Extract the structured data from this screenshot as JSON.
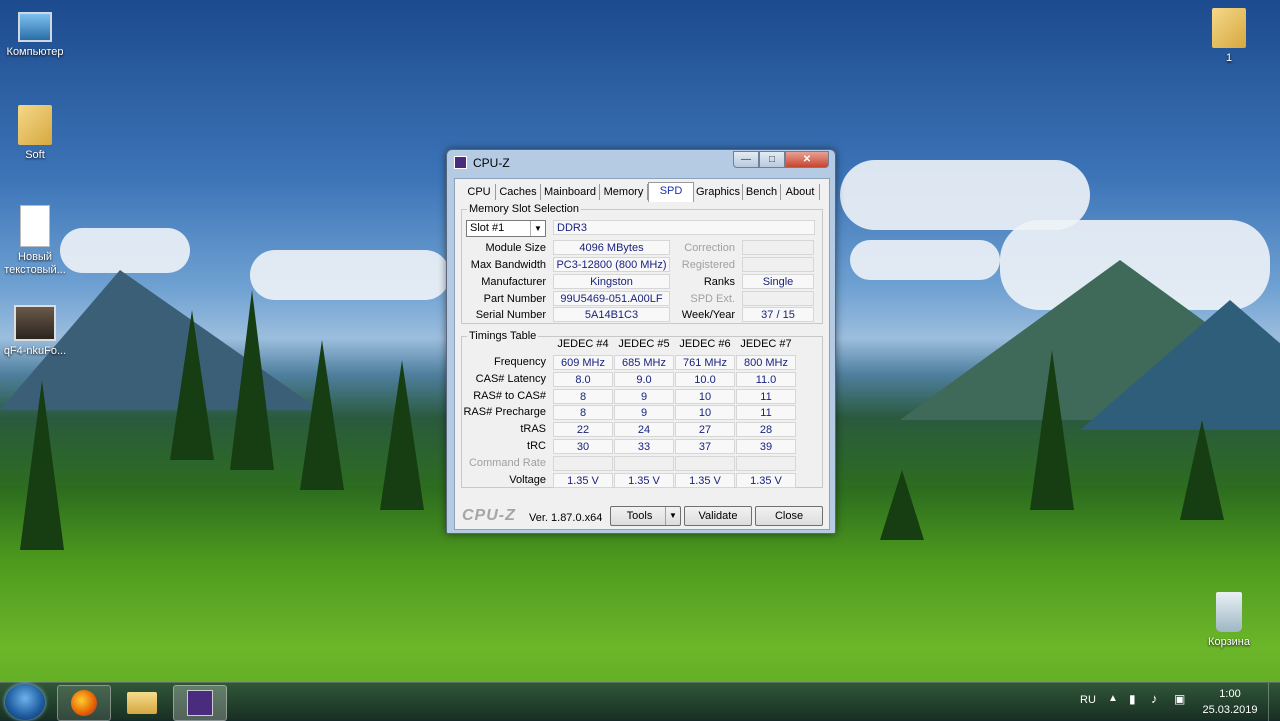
{
  "desktop": {
    "icons": [
      {
        "label": "Компьютер"
      },
      {
        "label": "Soft"
      },
      {
        "label": "Новый текстовый..."
      },
      {
        "label": "qF4-nkuFo..."
      },
      {
        "label": "1"
      },
      {
        "label": "Корзина"
      }
    ]
  },
  "window": {
    "title": "CPU-Z",
    "min": "—",
    "max": "□",
    "close": "✕",
    "tabs": [
      "CPU",
      "Caches",
      "Mainboard",
      "Memory",
      "SPD",
      "Graphics",
      "Bench",
      "About"
    ],
    "active_tab": "SPD",
    "slot_group": {
      "title": "Memory Slot Selection",
      "slot_selected": "Slot #1",
      "memory_type": "DDR3",
      "labels": {
        "module_size": "Module Size",
        "max_bandwidth": "Max Bandwidth",
        "manufacturer": "Manufacturer",
        "part_number": "Part Number",
        "serial_number": "Serial Number",
        "correction": "Correction",
        "registered": "Registered",
        "ranks": "Ranks",
        "spd_ext": "SPD Ext.",
        "week_year": "Week/Year"
      },
      "values": {
        "module_size": "4096 MBytes",
        "max_bandwidth": "PC3-12800 (800 MHz)",
        "manufacturer": "Kingston",
        "part_number": "99U5469-051.A00LF",
        "serial_number": "5A14B1C3",
        "correction": "",
        "registered": "",
        "ranks": "Single",
        "spd_ext": "",
        "week_year": "37 / 15"
      }
    },
    "timings": {
      "title": "Timings Table",
      "columns": [
        "JEDEC #4",
        "JEDEC #5",
        "JEDEC #6",
        "JEDEC #7"
      ],
      "rows": [
        {
          "label": "Frequency",
          "values": [
            "609 MHz",
            "685 MHz",
            "761 MHz",
            "800 MHz"
          ]
        },
        {
          "label": "CAS# Latency",
          "values": [
            "8.0",
            "9.0",
            "10.0",
            "11.0"
          ]
        },
        {
          "label": "RAS# to CAS#",
          "values": [
            "8",
            "9",
            "10",
            "11"
          ]
        },
        {
          "label": "RAS# Precharge",
          "values": [
            "8",
            "9",
            "10",
            "11"
          ]
        },
        {
          "label": "tRAS",
          "values": [
            "22",
            "24",
            "27",
            "28"
          ]
        },
        {
          "label": "tRC",
          "values": [
            "30",
            "33",
            "37",
            "39"
          ]
        },
        {
          "label": "Command Rate",
          "values": [
            "",
            "",
            "",
            ""
          ],
          "dim": true
        },
        {
          "label": "Voltage",
          "values": [
            "1.35 V",
            "1.35 V",
            "1.35 V",
            "1.35 V"
          ]
        }
      ]
    },
    "footer": {
      "logo": "CPU-Z",
      "version": "Ver. 1.87.0.x64",
      "tools": "Tools",
      "validate": "Validate",
      "close": "Close"
    }
  },
  "taskbar": {
    "language": "RU",
    "time": "1:00",
    "date": "25.03.2019"
  }
}
